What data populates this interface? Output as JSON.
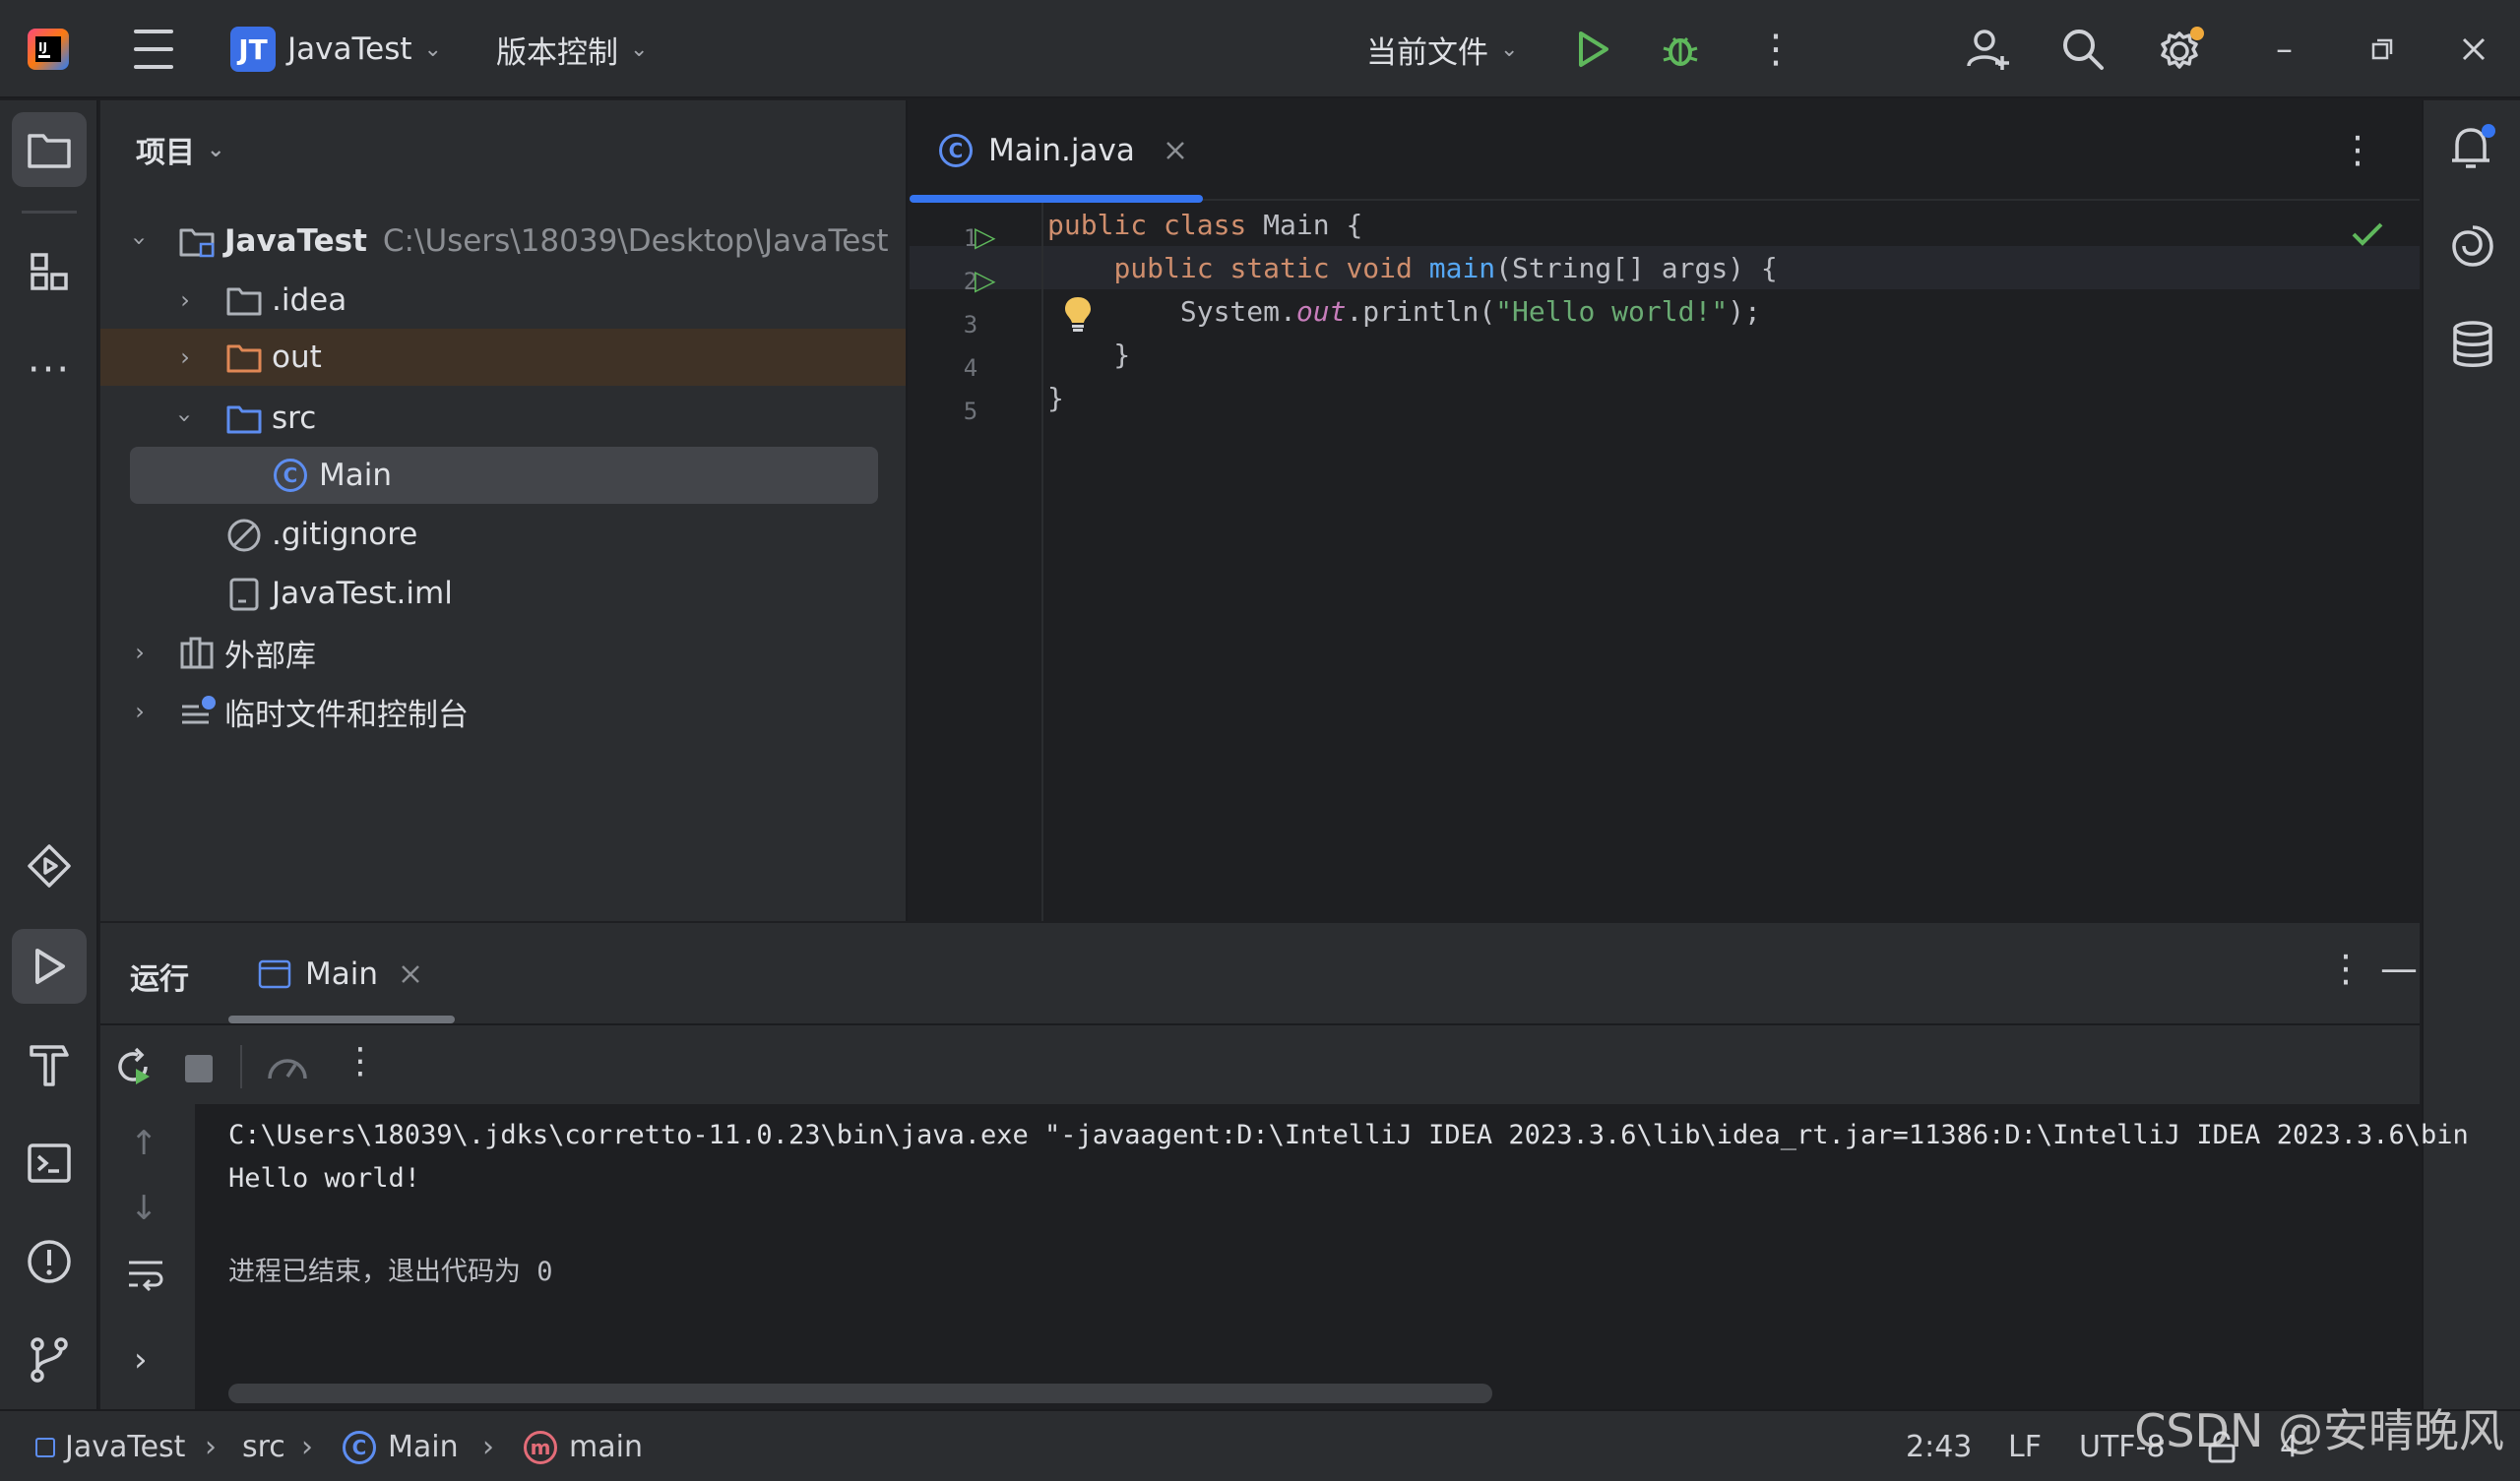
{
  "titlebar": {
    "project_badge": "JT",
    "project_name": "JavaTest",
    "vcs_label": "版本控制",
    "run_config": "当前文件"
  },
  "project_panel": {
    "header": "项目",
    "tree": [
      {
        "label": "JavaTest",
        "path": "C:\\Users\\18039\\Desktop\\JavaTest"
      },
      {
        "label": ".idea"
      },
      {
        "label": "out"
      },
      {
        "label": "src"
      },
      {
        "label": "Main"
      },
      {
        "label": ".gitignore"
      },
      {
        "label": "JavaTest.iml"
      },
      {
        "label": "外部库"
      },
      {
        "label": "临时文件和控制台"
      }
    ]
  },
  "editor": {
    "tab_label": "Main.java",
    "line_numbers": [
      "1",
      "2",
      "3",
      "4",
      "5"
    ],
    "code": {
      "l1_kw": "public class ",
      "l1_rest": "Main {",
      "l2_indent": "    ",
      "l2_kw": "public static void ",
      "l2_fn": "main",
      "l2_rest": "(String[] args) {",
      "l3_indent": "        ",
      "l3_a": "System.",
      "l3_b": "out",
      "l3_c": ".println(",
      "l3_str": "\"Hello world!\"",
      "l3_d": ");",
      "l4": "    }",
      "l5": "}"
    }
  },
  "run_panel": {
    "title": "运行",
    "tab_label": "Main",
    "console": [
      "C:\\Users\\18039\\.jdks\\corretto-11.0.23\\bin\\java.exe \"-javaagent:D:\\IntelliJ IDEA 2023.3.6\\lib\\idea_rt.jar=11386:D:\\IntelliJ IDEA 2023.3.6\\bin",
      "Hello world!",
      "",
      "进程已结束，退出代码为 0"
    ]
  },
  "statusbar": {
    "crumbs": [
      "JavaTest",
      "src",
      "Main",
      "main"
    ],
    "position": "2:43",
    "line_sep": "LF",
    "encoding": "UTF-8",
    "indent": "4"
  },
  "watermark": "CSDN @安晴晚风",
  "colors": {
    "accent": "#3574f0",
    "run_green": "#5fb85c",
    "excluded_bg": "#3f3226"
  }
}
